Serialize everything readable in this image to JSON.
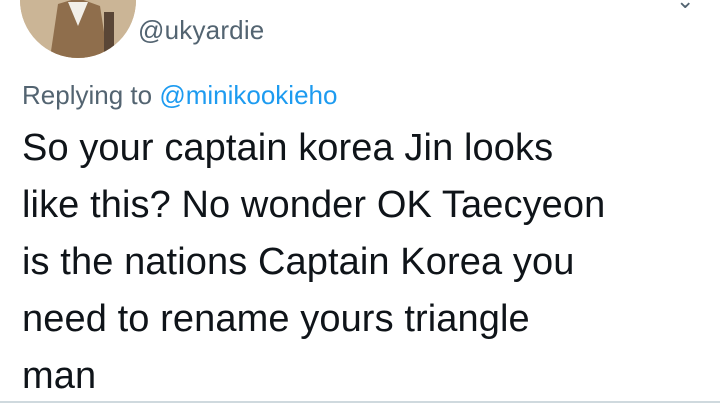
{
  "tweet": {
    "handle": "@ukyardie",
    "reply": {
      "prefix": "Replying to",
      "mention": "@minikookieho"
    },
    "text": "So your captain korea Jin looks\nlike this? No wonder OK Taecyeon\nis the nations Captain Korea you\nneed to rename yours triangle\nman"
  },
  "colors": {
    "link": "#1d9bf0",
    "secondary_text": "#536471",
    "primary_text": "#0f1419",
    "badge": "#e0245e"
  },
  "icons": [
    "avatar-image",
    "verified-badge-icon",
    "more-options-icon"
  ]
}
